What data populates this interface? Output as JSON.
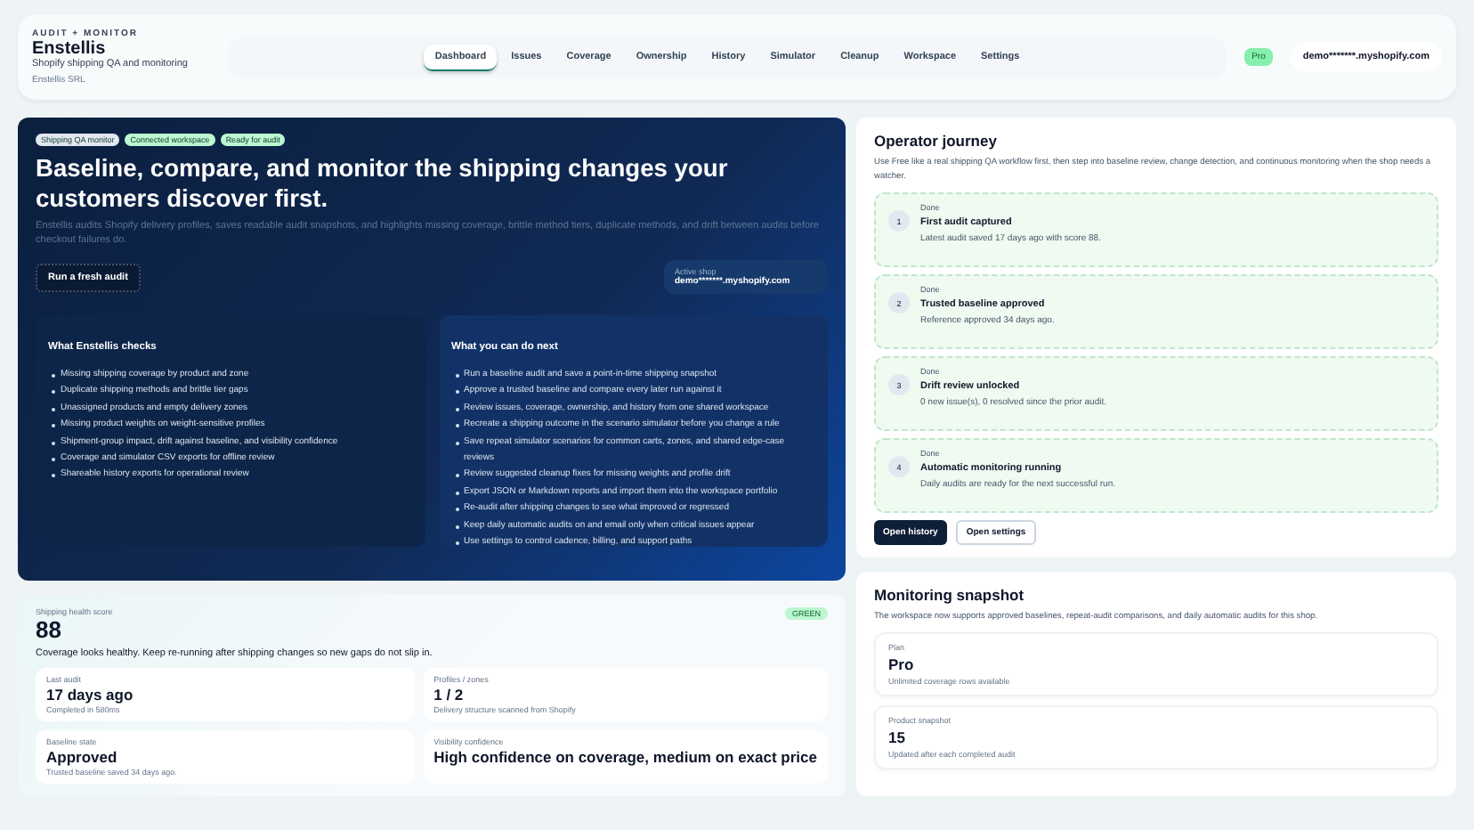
{
  "header": {
    "eyebrow": "AUDIT + MONITOR",
    "title": "Enstellis",
    "subtitle": "Shopify shipping QA and monitoring",
    "company": "Enstellis SRL",
    "nav": [
      {
        "label": "Dashboard",
        "selected": true
      },
      {
        "label": "Issues",
        "selected": false
      },
      {
        "label": "Coverage",
        "selected": false
      },
      {
        "label": "Ownership",
        "selected": false
      },
      {
        "label": "History",
        "selected": false
      },
      {
        "label": "Simulator",
        "selected": false
      },
      {
        "label": "Cleanup",
        "selected": false
      },
      {
        "label": "Workspace",
        "selected": false
      },
      {
        "label": "Settings",
        "selected": false
      }
    ],
    "plan_badge": "Pro",
    "shop": "demo*******.myshopify.com"
  },
  "hero": {
    "tags": [
      {
        "label": "Shipping QA monitor",
        "color": "#e2e8f0"
      },
      {
        "label": "Connected workspace",
        "color": "#bbf7d0"
      },
      {
        "label": "Ready for audit",
        "color": "#bbf7d0"
      }
    ],
    "title": "Baseline, compare, and monitor the shipping changes your customers discover first.",
    "description": "Enstellis audits Shopify delivery profiles, saves readable audit snapshots, and highlights missing coverage, brittle method tiers, duplicate methods, and drift between audits before checkout failures do.",
    "button": "Run a fresh audit",
    "active_shop_label": "Active shop",
    "active_shop": "demo*******.myshopify.com",
    "panels": [
      {
        "title": "What Enstellis checks",
        "items": [
          "Missing shipping coverage by product and zone",
          "Duplicate shipping methods and brittle tier gaps",
          "Unassigned products and empty delivery zones",
          "Missing product weights on weight-sensitive profiles",
          "Shipment-group impact, drift against baseline, and visibility confidence",
          "Coverage and simulator CSV exports for offline review",
          "Shareable history exports for operational review"
        ]
      },
      {
        "title": "What you can do next",
        "items": [
          "Run a baseline audit and save a point-in-time shipping snapshot",
          "Approve a trusted baseline and compare every later run against it",
          "Review issues, coverage, ownership, and history from one shared workspace",
          "Recreate a shipping outcome in the scenario simulator before you change a rule",
          "Save repeat simulator scenarios for common carts, zones, and shared edge-case reviews",
          "Review suggested cleanup fixes for missing weights and profile drift",
          "Export JSON or Markdown reports and import them into the workspace portfolio",
          "Re-audit after shipping changes to see what improved or regressed",
          "Keep daily automatic audits on and email only when critical issues appear",
          "Use settings to control cadence, billing, and support paths"
        ]
      }
    ]
  },
  "journey": {
    "title": "Operator journey",
    "intro": "Use Free like a real shipping QA workflow first, then step into baseline review, change detection, and continuous monitoring when the shop needs a watcher.",
    "steps": [
      {
        "number": "1",
        "status": "Done",
        "done": true,
        "title": "First audit captured",
        "text": "Latest audit saved 17 days ago with score 88."
      },
      {
        "number": "2",
        "status": "Done",
        "done": true,
        "title": "Trusted baseline approved",
        "text": "Reference approved 34 days ago."
      },
      {
        "number": "3",
        "status": "Done",
        "done": true,
        "title": "Drift review unlocked",
        "text": "0 new issue(s), 0 resolved since the prior audit."
      },
      {
        "number": "4",
        "status": "Done",
        "done": true,
        "title": "Automatic monitoring running",
        "text": "Daily audits are ready for the next successful run."
      }
    ],
    "buttons": [
      {
        "label": "Open history",
        "kind": "primary"
      },
      {
        "label": "Open settings",
        "kind": "secondary"
      }
    ]
  },
  "health": {
    "label": "Shipping health score",
    "score": "88",
    "badge": "GREEN",
    "summary": "Coverage looks healthy. Keep re-running after shipping changes so new gaps do not slip in.",
    "stats": [
      {
        "label": "Last audit",
        "value": "17 days ago",
        "note": "Completed in 580ms"
      },
      {
        "label": "Profiles / zones",
        "value": "1 / 2",
        "note": "Delivery structure scanned from Shopify"
      },
      {
        "label": "Baseline state",
        "value": "Approved",
        "note": "Trusted baseline saved 34 days ago."
      },
      {
        "label": "Visibility confidence",
        "value": "High confidence on coverage, medium on exact price"
      }
    ]
  },
  "snapshot": {
    "title": "Monitoring snapshot",
    "intro": "The workspace now supports approved baselines, repeat-audit comparisons, and daily automatic audits for this shop.",
    "stats": [
      {
        "label": "Plan",
        "value": "Pro",
        "note": "Unlimited coverage rows available"
      },
      {
        "label": "Product snapshot",
        "value": "15",
        "note": "Updated after each completed audit"
      }
    ]
  }
}
